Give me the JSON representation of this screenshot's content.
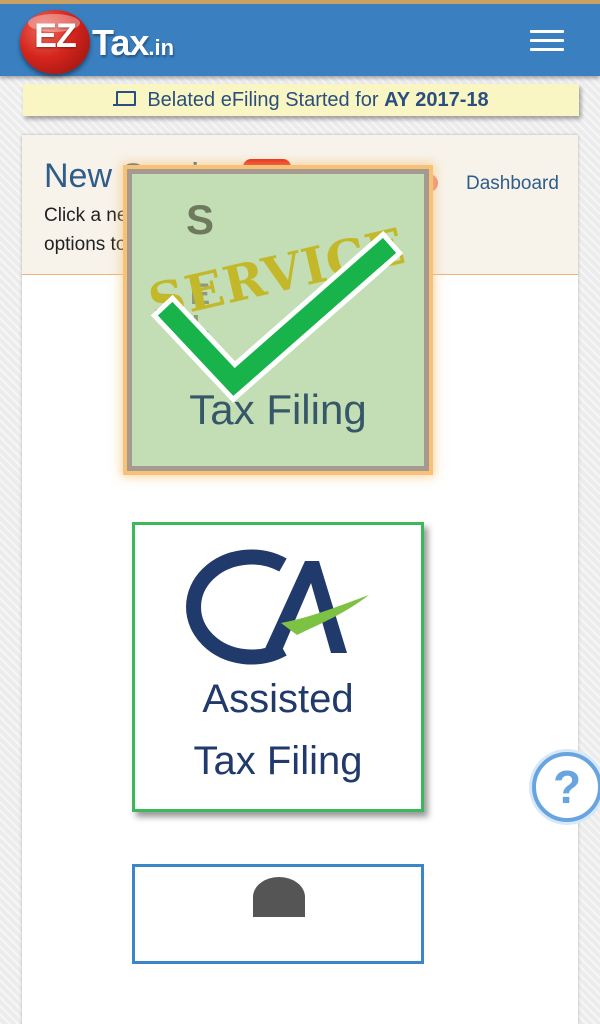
{
  "header": {
    "logo_ez": "EZ",
    "logo_tax": "Tax",
    "logo_tld": ".in",
    "menu_icon": "hamburger-icon"
  },
  "notice": {
    "icon": "laptop-icon",
    "text": "Belated eFiling Started for ",
    "highlight": "AY 2017-18"
  },
  "card": {
    "title": "New Service",
    "video_icon": "youtube-play-icon",
    "subtitle": "Click a new Service and choose few options to Continue",
    "toggle": {
      "on": false
    },
    "dashboard_link": "Dashboard"
  },
  "services": {
    "self_service": {
      "word_service": "SERVICE",
      "vertical_letters": "SELF",
      "label": "Tax Filing"
    },
    "ca_assisted": {
      "logo_text": "CA",
      "line1": "Assisted",
      "line2": "Tax Filing"
    },
    "third": {}
  },
  "help": {
    "glyph": "?",
    "icon": "help-icon"
  },
  "colors": {
    "header_bg": "#3a7fc0",
    "header_top_border": "#c8a165",
    "notice_bg": "#faf6c4",
    "brand_text": "#2f5d8a",
    "youtube_red": "#e62117",
    "toggle_track": "#f28b82",
    "service_tile_bg": "#c3ddb4",
    "service_tile_glow": "#f7c176",
    "check_green": "#18b34a",
    "ca_border": "#3bb95a",
    "ca_navy": "#203a6b",
    "help_blue": "#68a5e0"
  }
}
